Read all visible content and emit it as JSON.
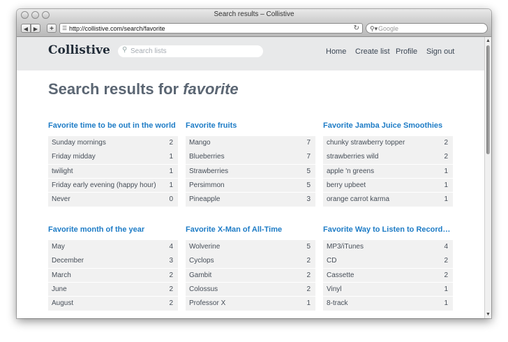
{
  "window": {
    "title": "Search results – Collistive"
  },
  "toolbar": {
    "back_icon": "◀",
    "forward_icon": "▶",
    "add_icon": "+",
    "url": "http://collistive.com/search/favorite",
    "reload_icon": "↻",
    "search_placeholder": "Google"
  },
  "site": {
    "logo": "Collistive",
    "search_placeholder": "Search lists",
    "nav": [
      "Home",
      "Create list",
      "Profile",
      "Sign out"
    ]
  },
  "page": {
    "title_prefix": "Search results for ",
    "query": "favorite"
  },
  "lists": [
    {
      "title": "Favorite time to be out in the world",
      "items": [
        {
          "label": "Sunday mornings",
          "count": "2"
        },
        {
          "label": "Friday midday",
          "count": "1"
        },
        {
          "label": "twilight",
          "count": "1"
        },
        {
          "label": "Friday early evening (happy hour)",
          "count": "1"
        },
        {
          "label": "Never",
          "count": "0"
        }
      ]
    },
    {
      "title": "Favorite fruits",
      "items": [
        {
          "label": "Mango",
          "count": "7"
        },
        {
          "label": "Blueberries",
          "count": "7"
        },
        {
          "label": "Strawberries",
          "count": "5"
        },
        {
          "label": "Persimmon",
          "count": "5"
        },
        {
          "label": "Pineapple",
          "count": "3"
        }
      ]
    },
    {
      "title": "Favorite Jamba Juice Smoothies",
      "items": [
        {
          "label": "chunky strawberry topper",
          "count": "2"
        },
        {
          "label": "strawberries wild",
          "count": "2"
        },
        {
          "label": "apple 'n greens",
          "count": "1"
        },
        {
          "label": "berry upbeet",
          "count": "1"
        },
        {
          "label": "orange carrot karma",
          "count": "1"
        }
      ]
    },
    {
      "title": "Favorite month of the year",
      "items": [
        {
          "label": "May",
          "count": "4"
        },
        {
          "label": "December",
          "count": "3"
        },
        {
          "label": "March",
          "count": "2"
        },
        {
          "label": "June",
          "count": "2"
        },
        {
          "label": "August",
          "count": "2"
        }
      ]
    },
    {
      "title": "Favorite X-Man of All-Time",
      "items": [
        {
          "label": "Wolverine",
          "count": "5"
        },
        {
          "label": "Cyclops",
          "count": "2"
        },
        {
          "label": "Gambit",
          "count": "2"
        },
        {
          "label": "Colossus",
          "count": "2"
        },
        {
          "label": "Professor X",
          "count": "1"
        }
      ]
    },
    {
      "title": "Favorite Way to Listen to Recorde…",
      "items": [
        {
          "label": "MP3/iTunes",
          "count": "4"
        },
        {
          "label": "CD",
          "count": "2"
        },
        {
          "label": "Cassette",
          "count": "2"
        },
        {
          "label": "Vinyl",
          "count": "1"
        },
        {
          "label": "8-track",
          "count": "1"
        }
      ]
    }
  ],
  "colors": {
    "link": "#1e7cc6",
    "header_bg": "#e8e9ea",
    "row_bg": "#f1f1f1",
    "title": "#5b6673"
  }
}
